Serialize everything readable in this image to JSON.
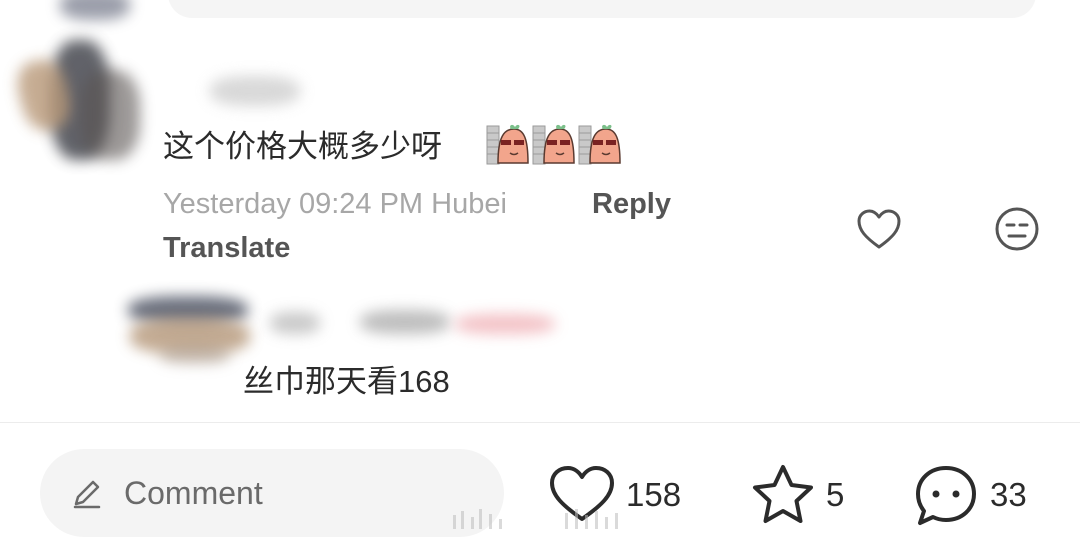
{
  "comment": {
    "text": "这个价格大概多少呀",
    "sticker_icon": "sunglasses-sticker-icon",
    "sticker_count": 3,
    "timestamp": "Yesterday 09:24 PM",
    "location": "Hubei",
    "reply_label": "Reply",
    "translate_label": "Translate",
    "like_icon": "heart-outline-icon",
    "dislike_icon": "neutral-face-icon"
  },
  "reply": {
    "text": "丝巾那天看168"
  },
  "bottom_bar": {
    "comment_placeholder": "Comment",
    "likes": "158",
    "collects": "5",
    "comments": "33"
  },
  "colors": {
    "background": "#ffffff",
    "text_primary": "#2b2b2b",
    "text_secondary": "#a7a7a7",
    "input_bg": "#f4f4f4"
  }
}
